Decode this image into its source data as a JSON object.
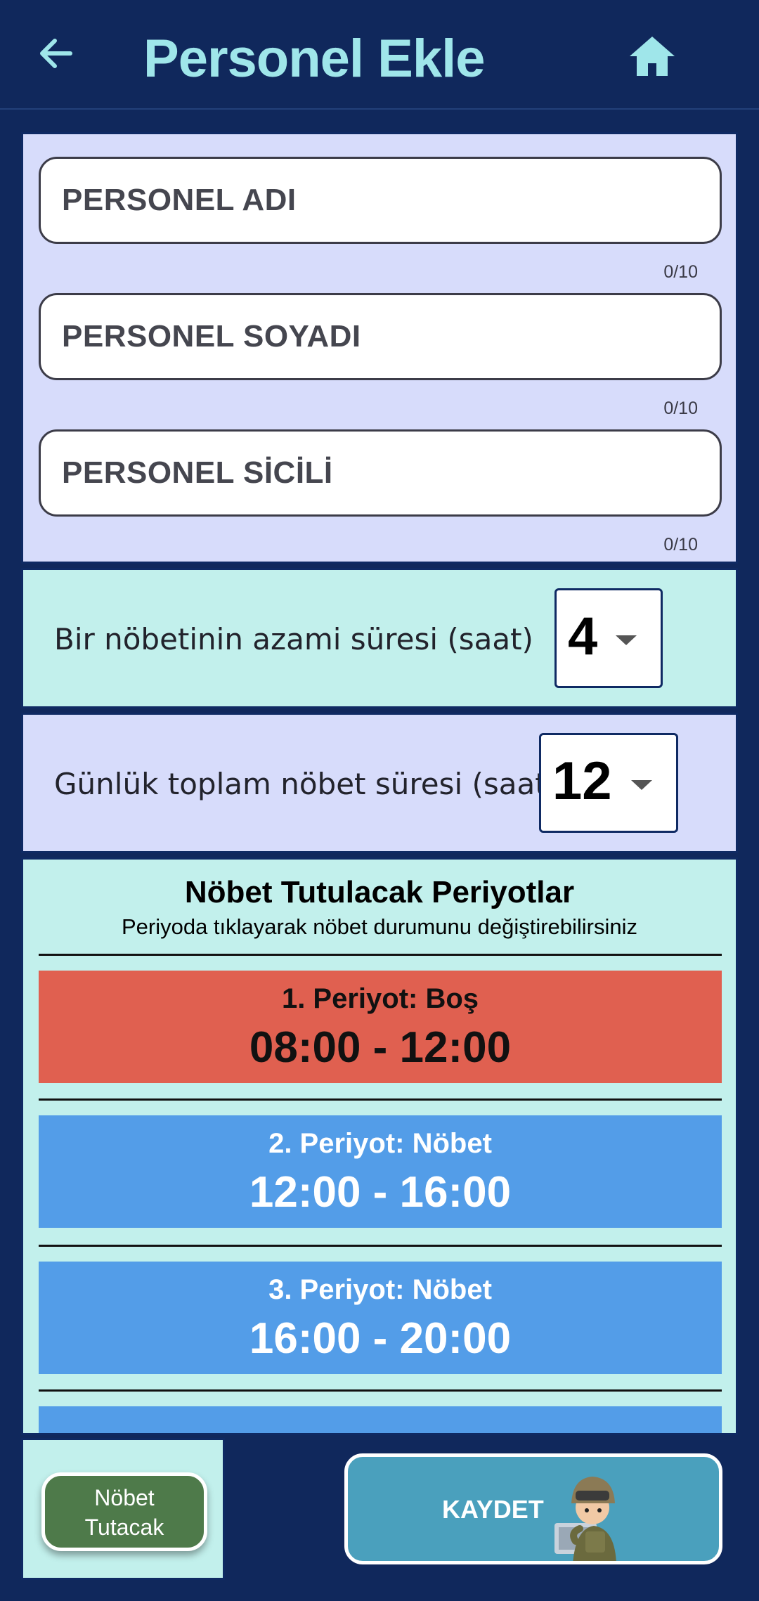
{
  "header": {
    "title": "Personel Ekle",
    "back_icon": "arrow-left-icon",
    "home_icon": "home-icon"
  },
  "form": {
    "first_name": {
      "placeholder": "PERSONEL ADI",
      "value": "",
      "counter": "0/10"
    },
    "last_name": {
      "placeholder": "PERSONEL SOYADI",
      "value": "",
      "counter": "0/10"
    },
    "registry": {
      "placeholder": "PERSONEL SİCİLİ",
      "value": "",
      "counter": "0/10"
    }
  },
  "max_shift": {
    "label": "Bir nöbetinin azami süresi (saat)",
    "value": "4"
  },
  "daily_total": {
    "label": "Günlük toplam nöbet süresi (saat)",
    "value": "12"
  },
  "periods": {
    "title": "Nöbet Tutulacak Periyotlar",
    "subtitle": "Periyoda tıklayarak nöbet durumunu değiştirebilirsiniz",
    "items": [
      {
        "label": "1. Periyot: Boş",
        "time": "08:00 - 12:00",
        "status": "empty"
      },
      {
        "label": "2. Periyot: Nöbet",
        "time": "12:00 - 16:00",
        "status": "duty"
      },
      {
        "label": "3. Periyot: Nöbet",
        "time": "16:00 - 20:00",
        "status": "duty"
      }
    ]
  },
  "legend": {
    "line1": "Nöbet",
    "line2": "Tutacak"
  },
  "save": {
    "label": "KAYDET",
    "image": "soldier-mascot"
  },
  "colors": {
    "background": "#10285c",
    "title": "#9fe6ea",
    "empty_period": "#e06050",
    "duty_period": "#539de8",
    "legend_button": "#4e7a4a",
    "save_button": "#4aa0bd"
  }
}
